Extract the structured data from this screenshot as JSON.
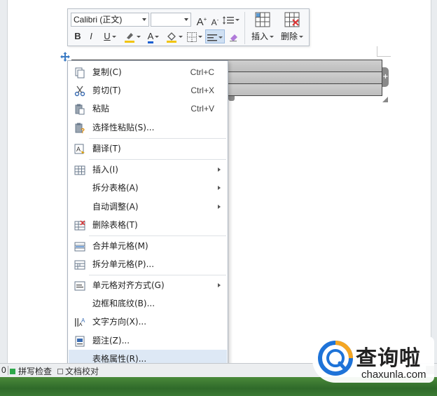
{
  "toolbar": {
    "font_name": "Calibri (正文)",
    "font_size": "",
    "grow_font": "A",
    "shrink_font": "A",
    "bold": "B",
    "italic": "I",
    "underline": "U",
    "font_color": "A",
    "insert_label": "插入",
    "delete_label": "删除"
  },
  "menu": {
    "items": [
      {
        "label": "复制(C)",
        "shortcut": "Ctrl+C",
        "icon": "copy-icon"
      },
      {
        "label": "剪切(T)",
        "shortcut": "Ctrl+X",
        "icon": "scissors-icon"
      },
      {
        "label": "粘贴",
        "shortcut": "Ctrl+V",
        "icon": "paste-icon"
      },
      {
        "label": "选择性粘贴(S)...",
        "shortcut": "",
        "icon": "paste-special-icon"
      },
      {
        "label": "翻译(T)",
        "shortcut": "",
        "icon": "translate-icon"
      },
      {
        "label": "插入(I)",
        "shortcut": "",
        "icon": "table-insert-icon",
        "submenu": true
      },
      {
        "label": "拆分表格(A)",
        "shortcut": "",
        "icon": "",
        "submenu": true
      },
      {
        "label": "自动调整(A)",
        "shortcut": "",
        "icon": "",
        "submenu": true
      },
      {
        "label": "删除表格(T)",
        "shortcut": "",
        "icon": "delete-table-icon"
      },
      {
        "label": "合并单元格(M)",
        "shortcut": "",
        "icon": "merge-cells-icon"
      },
      {
        "label": "拆分单元格(P)...",
        "shortcut": "",
        "icon": "split-cells-icon"
      },
      {
        "label": "单元格对齐方式(G)",
        "shortcut": "",
        "icon": "cell-align-icon",
        "submenu": true
      },
      {
        "label": "边框和底纹(B)...",
        "shortcut": "",
        "icon": ""
      },
      {
        "label": "文字方向(X)...",
        "shortcut": "",
        "icon": "text-direction-icon"
      },
      {
        "label": "题注(Z)...",
        "shortcut": "",
        "icon": "caption-icon"
      },
      {
        "label": "表格属性(R)...",
        "shortcut": "",
        "icon": "",
        "highlighted": true
      }
    ]
  },
  "status_bar": {
    "zero": "0",
    "spell_check": "拼写检查",
    "proofread": "文档校对"
  },
  "watermark": {
    "chinese": "查询啦",
    "english": "chaxunla.com"
  },
  "colors": {
    "accent_blue": "#3b7bc4",
    "highlight": "#dde8f5",
    "status_green": "#2ea84a"
  }
}
